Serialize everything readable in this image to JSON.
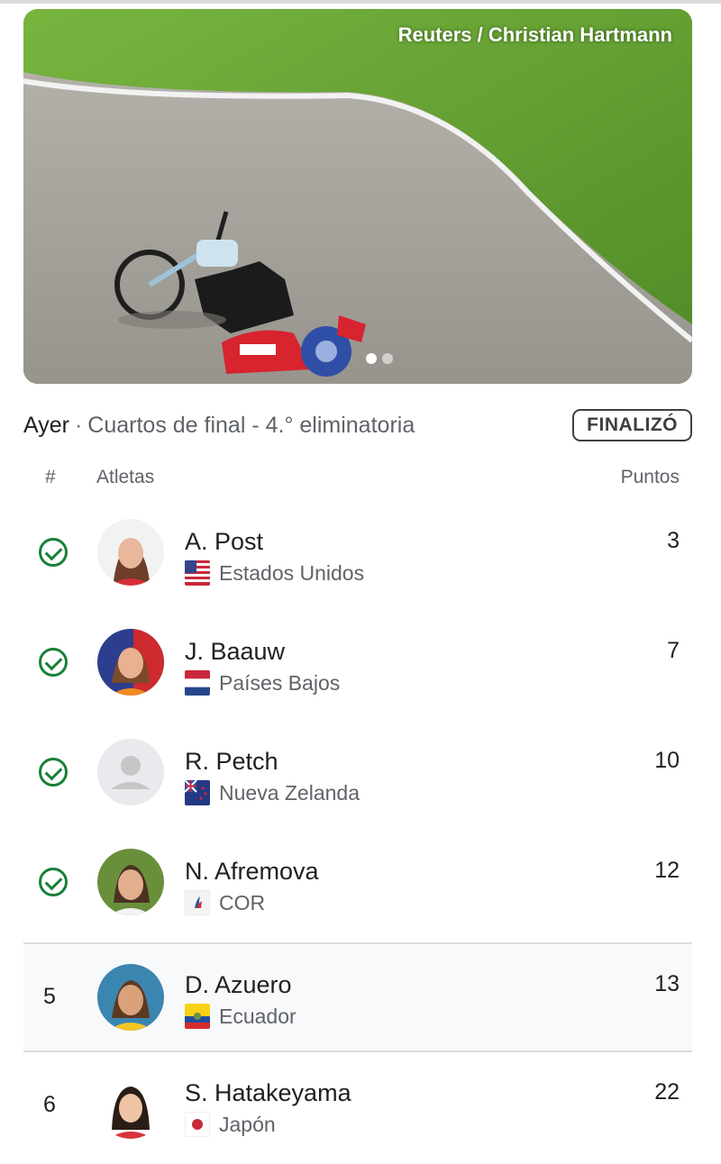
{
  "photo": {
    "credit": "Reuters / Christian Hartmann",
    "carousel": {
      "total": 2,
      "active": 1
    }
  },
  "event": {
    "day": "Ayer",
    "separator": "·",
    "round": "Cuartos de final - 4.° eliminatoria",
    "status": "FINALIZÓ"
  },
  "table": {
    "headers": {
      "rank": "#",
      "athletes": "Atletas",
      "points": "Puntos"
    },
    "rows": [
      {
        "rank": "",
        "qualified": true,
        "name": "A. Post",
        "country": "Estados Unidos",
        "flag": "flag-usa",
        "points": "3"
      },
      {
        "rank": "",
        "qualified": true,
        "name": "J. Baauw",
        "country": "Países Bajos",
        "flag": "flag-netherlands",
        "points": "7"
      },
      {
        "rank": "",
        "qualified": true,
        "name": "R. Petch",
        "country": "Nueva Zelanda",
        "flag": "flag-new-zealand",
        "points": "10"
      },
      {
        "rank": "",
        "qualified": true,
        "name": "N. Afremova",
        "country": "COR",
        "flag": "flag-roc",
        "points": "12"
      },
      {
        "rank": "5",
        "qualified": false,
        "name": "D. Azuero",
        "country": "Ecuador",
        "flag": "flag-ecuador",
        "points": "13"
      },
      {
        "rank": "6",
        "qualified": false,
        "name": "S. Hatakeyama",
        "country": "Japón",
        "flag": "flag-japan",
        "points": "22"
      }
    ]
  },
  "colors": {
    "qualified_check": "#188038",
    "highlight_row": "#f8f9fa",
    "text_primary": "#202124",
    "text_secondary": "#5f6368"
  }
}
